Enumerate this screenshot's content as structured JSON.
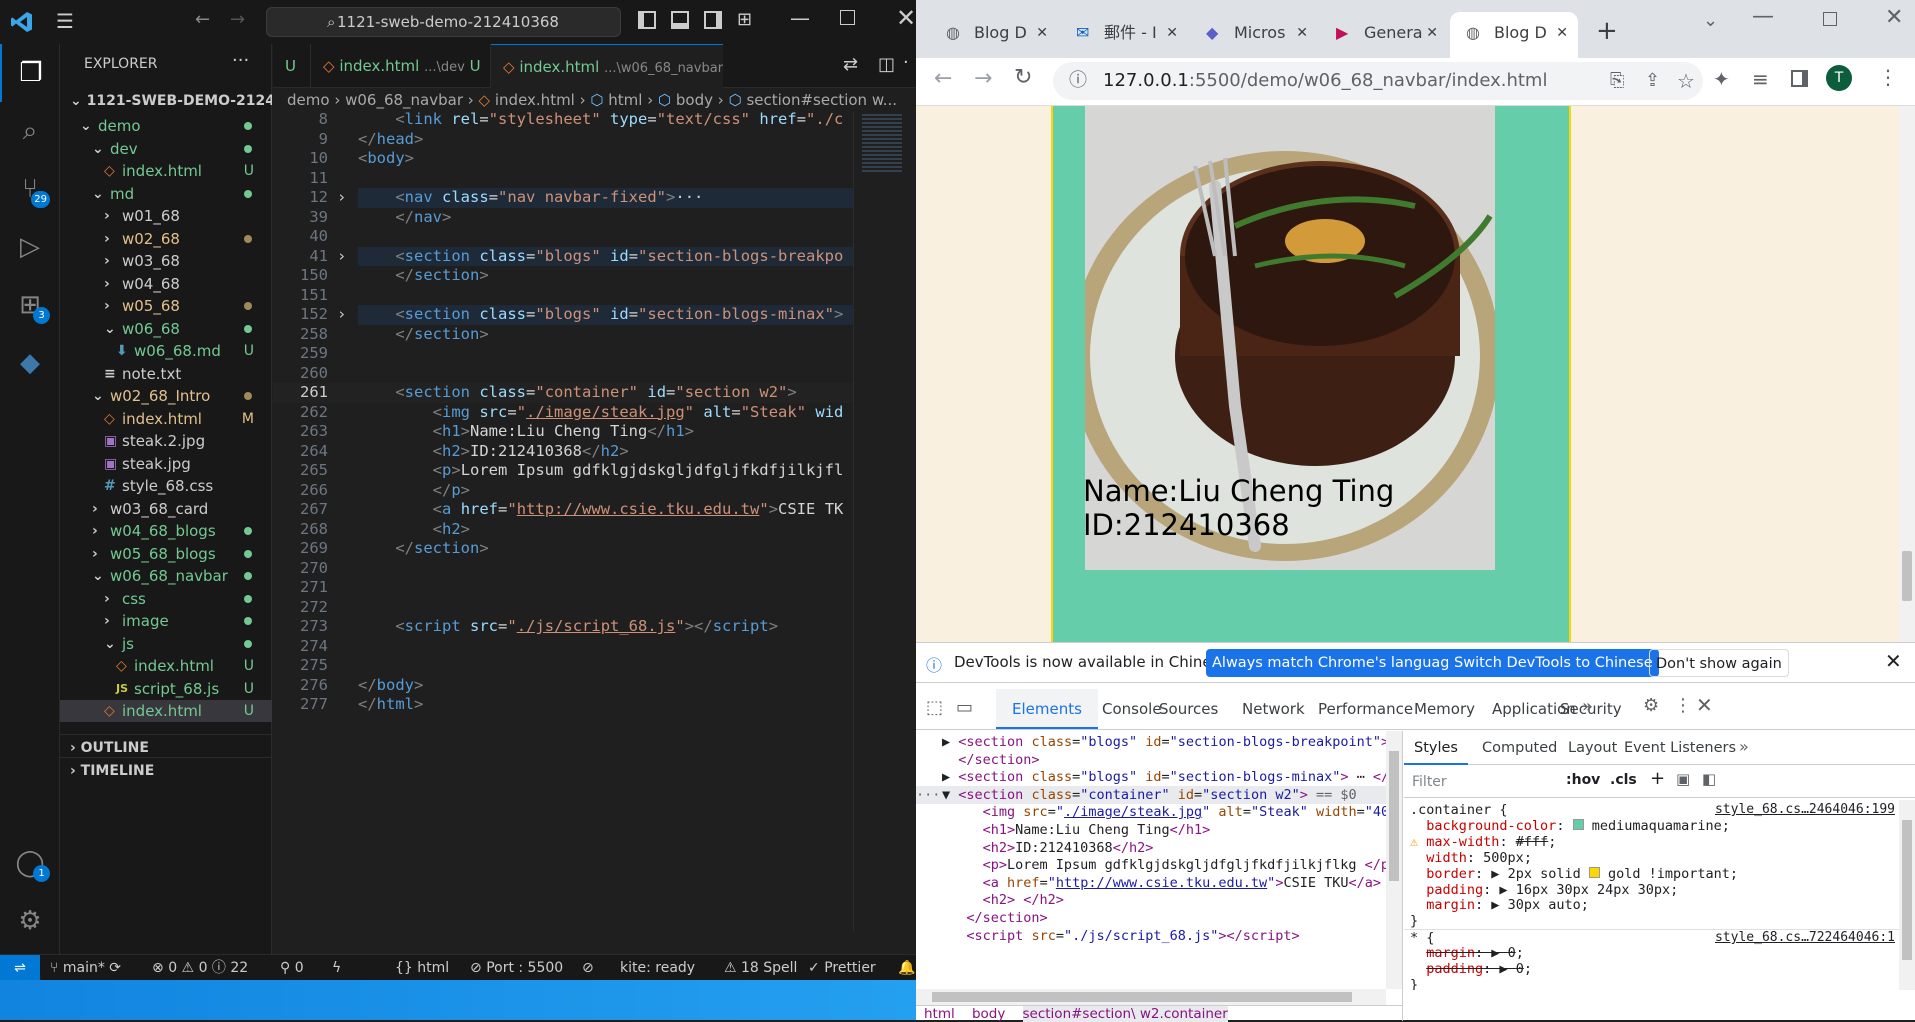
{
  "vscode": {
    "search_text": "1121-sweb-demo-212410368",
    "tabs": [
      {
        "name": "U",
        "path": "",
        "status": ""
      },
      {
        "name": "index.html",
        "path": "...\\dev",
        "status": "U"
      },
      {
        "name": "index.html",
        "path": "...\\w06_68_navbar",
        "status": "U"
      }
    ],
    "explorer_title": "EXPLORER",
    "workspace": "1121-SWEB-DEMO-21241...",
    "tree": [
      {
        "name": "demo",
        "indent": 1,
        "kind": "folder-open",
        "status": "dot"
      },
      {
        "name": "dev",
        "indent": 2,
        "kind": "folder-open",
        "status": "dot"
      },
      {
        "name": "index.html",
        "indent": 3,
        "kind": "html",
        "status": "U"
      },
      {
        "name": "md",
        "indent": 2,
        "kind": "folder-open",
        "status": "dot"
      },
      {
        "name": "w01_68",
        "indent": 3,
        "kind": "folder",
        "status": ""
      },
      {
        "name": "w02_68",
        "indent": 3,
        "kind": "folder",
        "status": "mdot"
      },
      {
        "name": "w03_68",
        "indent": 3,
        "kind": "folder",
        "status": ""
      },
      {
        "name": "w04_68",
        "indent": 3,
        "kind": "folder",
        "status": ""
      },
      {
        "name": "w05_68",
        "indent": 3,
        "kind": "folder",
        "status": "mdot"
      },
      {
        "name": "w06_68",
        "indent": 3,
        "kind": "folder-open",
        "status": "dot"
      },
      {
        "name": "w06_68.md",
        "indent": 4,
        "kind": "md",
        "status": "U"
      },
      {
        "name": "note.txt",
        "indent": 3,
        "kind": "txt",
        "status": ""
      },
      {
        "name": "w02_68_Intro",
        "indent": 2,
        "kind": "folder-open",
        "status": "mdot"
      },
      {
        "name": "index.html",
        "indent": 3,
        "kind": "html",
        "status": "M"
      },
      {
        "name": "steak.2.jpg",
        "indent": 3,
        "kind": "img",
        "status": ""
      },
      {
        "name": "steak.jpg",
        "indent": 3,
        "kind": "img",
        "status": ""
      },
      {
        "name": "style_68.css",
        "indent": 3,
        "kind": "css",
        "status": ""
      },
      {
        "name": "w03_68_card",
        "indent": 2,
        "kind": "folder",
        "status": ""
      },
      {
        "name": "w04_68_blogs",
        "indent": 2,
        "kind": "folder",
        "status": "dot"
      },
      {
        "name": "w05_68_blogs",
        "indent": 2,
        "kind": "folder",
        "status": "dot"
      },
      {
        "name": "w06_68_navbar",
        "indent": 2,
        "kind": "folder-open",
        "status": "dot"
      },
      {
        "name": "css",
        "indent": 3,
        "kind": "folder",
        "status": "dot"
      },
      {
        "name": "image",
        "indent": 3,
        "kind": "folder",
        "status": "dot"
      },
      {
        "name": "js",
        "indent": 3,
        "kind": "folder-open",
        "status": "dot"
      },
      {
        "name": "index.html",
        "indent": 4,
        "kind": "html",
        "status": "U"
      },
      {
        "name": "script_68.js",
        "indent": 4,
        "kind": "js",
        "status": "U"
      },
      {
        "name": "index.html",
        "indent": 3,
        "kind": "html",
        "status": "U",
        "selected": true
      }
    ],
    "outline": "OUTLINE",
    "timeline": "TIMELINE",
    "breadcrumb": [
      "demo",
      "w06_68_navbar",
      "index.html",
      "html",
      "body",
      "section#section w..."
    ],
    "code": [
      {
        "n": "8",
        "html": "    <span class='p'>&lt;</span><span class='t'>link</span> <span class='a'>rel</span><span class='w'>=</span><span class='s'>\"stylesheet\"</span> <span class='a'>type</span><span class='w'>=</span><span class='s'>\"text/css\"</span> <span class='a'>href</span><span class='w'>=</span><span class='s'>\"./c</span>"
      },
      {
        "n": "9",
        "html": "<span class='p'>&lt;/</span><span class='t'>head</span><span class='p'>&gt;</span>"
      },
      {
        "n": "10",
        "html": "<span class='p'>&lt;</span><span class='t'>body</span><span class='p'>&gt;</span>"
      },
      {
        "n": "11",
        "html": ""
      },
      {
        "n": "12",
        "html": "    <span class='p'>&lt;</span><span class='t'>nav</span> <span class='a'>class</span><span class='w'>=</span><span class='s'>\"nav navbar-fixed\"</span><span class='p'>&gt;</span><span class='w'>···</span>",
        "fold": true,
        "hl": true
      },
      {
        "n": "39",
        "html": "    <span class='p'>&lt;/</span><span class='t'>nav</span><span class='p'>&gt;</span>"
      },
      {
        "n": "40",
        "html": ""
      },
      {
        "n": "41",
        "html": "    <span class='p'>&lt;</span><span class='t'>section</span> <span class='a'>class</span><span class='w'>=</span><span class='s'>\"blogs\"</span> <span class='a'>id</span><span class='w'>=</span><span class='s'>\"section-blogs-breakpo</span>",
        "fold": true,
        "hl": true
      },
      {
        "n": "150",
        "html": "    <span class='p'>&lt;/</span><span class='t'>section</span><span class='p'>&gt;</span>"
      },
      {
        "n": "151",
        "html": ""
      },
      {
        "n": "152",
        "html": "    <span class='p'>&lt;</span><span class='t'>section</span> <span class='a'>class</span><span class='w'>=</span><span class='s'>\"blogs\"</span> <span class='a'>id</span><span class='w'>=</span><span class='s'>\"section-blogs-minax\"</span><span class='p'>&gt;</span>",
        "fold": true,
        "hl": true
      },
      {
        "n": "258",
        "html": "    <span class='p'>&lt;/</span><span class='t'>section</span><span class='p'>&gt;</span>"
      },
      {
        "n": "259",
        "html": ""
      },
      {
        "n": "260",
        "html": ""
      },
      {
        "n": "261",
        "html": "    <span class='p'>&lt;</span><span class='t'>section</span> <span class='a'>class</span><span class='w'>=</span><span class='s'>\"container\"</span> <span class='a'>id</span><span class='w'>=</span><span class='s'>\"section w2\"</span><span class='p'>&gt;</span>",
        "cur": true
      },
      {
        "n": "262",
        "html": "        <span class='p'>&lt;</span><span class='t'>img</span> <span class='a'>src</span><span class='w'>=</span><span class='s'>\"<u>./image/steak.jpg</u>\"</span> <span class='a'>alt</span><span class='w'>=</span><span class='s'>\"Steak\"</span> <span class='a'>wid</span>"
      },
      {
        "n": "263",
        "html": "        <span class='p'>&lt;</span><span class='t'>h1</span><span class='p'>&gt;</span><span class='w'>Name:Liu Cheng Ting</span><span class='p'>&lt;/</span><span class='t'>h1</span><span class='p'>&gt;</span>"
      },
      {
        "n": "264",
        "html": "        <span class='p'>&lt;</span><span class='t'>h2</span><span class='p'>&gt;</span><span class='w'>ID:212410368</span><span class='p'>&lt;/</span><span class='t'>h2</span><span class='p'>&gt;</span>"
      },
      {
        "n": "265",
        "html": "        <span class='p'>&lt;</span><span class='t'>p</span><span class='p'>&gt;</span><span class='w'>Lorem Ipsum gdfklgjdskgljdfgljfkdfjilkjfl</span>"
      },
      {
        "n": "266",
        "html": "        <span class='p'>&lt;/</span><span class='t'>p</span><span class='p'>&gt;</span>"
      },
      {
        "n": "267",
        "html": "        <span class='p'>&lt;</span><span class='t'>a</span> <span class='a'>href</span><span class='w'>=</span><span class='s'>\"<u>http://www.csie.tku.edu.tw</u>\"</span><span class='p'>&gt;</span><span class='w'>CSIE TK</span>"
      },
      {
        "n": "268",
        "html": "        <span class='p'>&lt;</span><span class='t'>h2</span><span class='p'>&gt;</span>"
      },
      {
        "n": "269",
        "html": "    <span class='p'>&lt;/</span><span class='t'>section</span><span class='p'>&gt;</span>"
      },
      {
        "n": "270",
        "html": ""
      },
      {
        "n": "271",
        "html": ""
      },
      {
        "n": "272",
        "html": ""
      },
      {
        "n": "273",
        "html": "    <span class='p'>&lt;</span><span class='t'>script</span> <span class='a'>src</span><span class='w'>=</span><span class='s'>\"<u>./js/script_68.js</u>\"</span><span class='p'>&gt;&lt;/</span><span class='t'>script</span><span class='p'>&gt;</span>"
      },
      {
        "n": "274",
        "html": ""
      },
      {
        "n": "275",
        "html": ""
      },
      {
        "n": "276",
        "html": "<span class='p'>&lt;/</span><span class='t'>body</span><span class='p'>&gt;</span>"
      },
      {
        "n": "277",
        "html": "<span class='p'>&lt;/</span><span class='t'>html</span><span class='p'>&gt;</span>"
      }
    ],
    "status": {
      "branch": "main*",
      "errors": "0",
      "warnings": "0",
      "info": "22",
      "ports": "0",
      "language": "html",
      "port": "Port : 5500",
      "kite": "kite: ready",
      "spell": "18 Spell",
      "prettier": "Prettier"
    },
    "badges": {
      "scm": "29",
      "extensions": "3",
      "account": "1"
    }
  },
  "chrome": {
    "tabs": [
      {
        "label": "Blog D",
        "icon": "globe-icon"
      },
      {
        "label": "郵件 - I",
        "icon": "outlook-icon"
      },
      {
        "label": "Micros",
        "icon": "teams-icon"
      },
      {
        "label": "Genera",
        "icon": "play-icon"
      },
      {
        "label": "Blog D",
        "icon": "globe-icon",
        "active": true
      }
    ],
    "url_host": "127.0.0.1",
    "url_rest": ":5500/demo/w06_68_navbar/index.html",
    "profile_initial": "T",
    "page": {
      "h1": "Name:Liu Cheng Ting",
      "h2": "ID:212410368",
      "bg": "#faf0e0",
      "container_bg": "#66cdaa",
      "border": "#ffd700"
    },
    "devtools": {
      "notice": "DevTools is now available in Chinese!",
      "btn_match": "Always match Chrome's language",
      "btn_switch": "Switch DevTools to Chinese",
      "btn_dont": "Don't show again",
      "tabs": [
        "Elements",
        "Console",
        "Sources",
        "Network",
        "Performance",
        "Memory",
        "Application",
        "Security"
      ],
      "style_tabs": [
        "Styles",
        "Computed",
        "Layout",
        "Event Listeners"
      ],
      "filter_placeholder": "Filter",
      "hov": ":hov",
      "cls": ".cls",
      "rule1_source": "style_68.cs…2464046:199",
      "rule2_source": "style_68.cs…722464046:1",
      "crumbs": [
        "html",
        "body",
        "section#section\\ w2.container"
      ]
    }
  }
}
